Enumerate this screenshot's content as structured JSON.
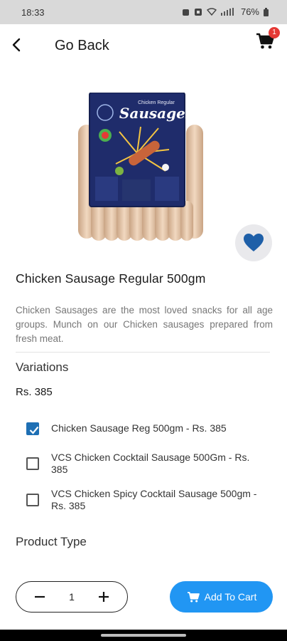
{
  "status_bar": {
    "time": "18:33",
    "battery": "76%"
  },
  "header": {
    "back_label": "Go Back",
    "cart_count": "1"
  },
  "product": {
    "image_brand": "Chicken Regular",
    "image_title": "Sausages",
    "title": "Chicken Sausage Regular 500gm",
    "description": " Chicken Sausages are the most loved snacks for all age groups. Munch on our Chicken sausages prepared from fresh meat.",
    "favorite": true
  },
  "variations": {
    "heading": "Variations",
    "price": "Rs. 385",
    "options": [
      {
        "label": "Chicken Sausage Reg 500gm - Rs. 385",
        "checked": true
      },
      {
        "label": "VCS Chicken Cocktail Sausage 500Gm - Rs. 385",
        "checked": false
      },
      {
        "label": "VCS Chicken Spicy Cocktail Sausage 500gm - Rs. 385",
        "checked": false
      }
    ]
  },
  "product_type": {
    "heading": "Product Type"
  },
  "footer": {
    "quantity": "1",
    "add_to_cart_label": "Add To Cart"
  },
  "colors": {
    "accent": "#2196f3",
    "checkbox": "#1e6fb4",
    "favorite": "#1e5fa8",
    "badge": "#e53935"
  }
}
